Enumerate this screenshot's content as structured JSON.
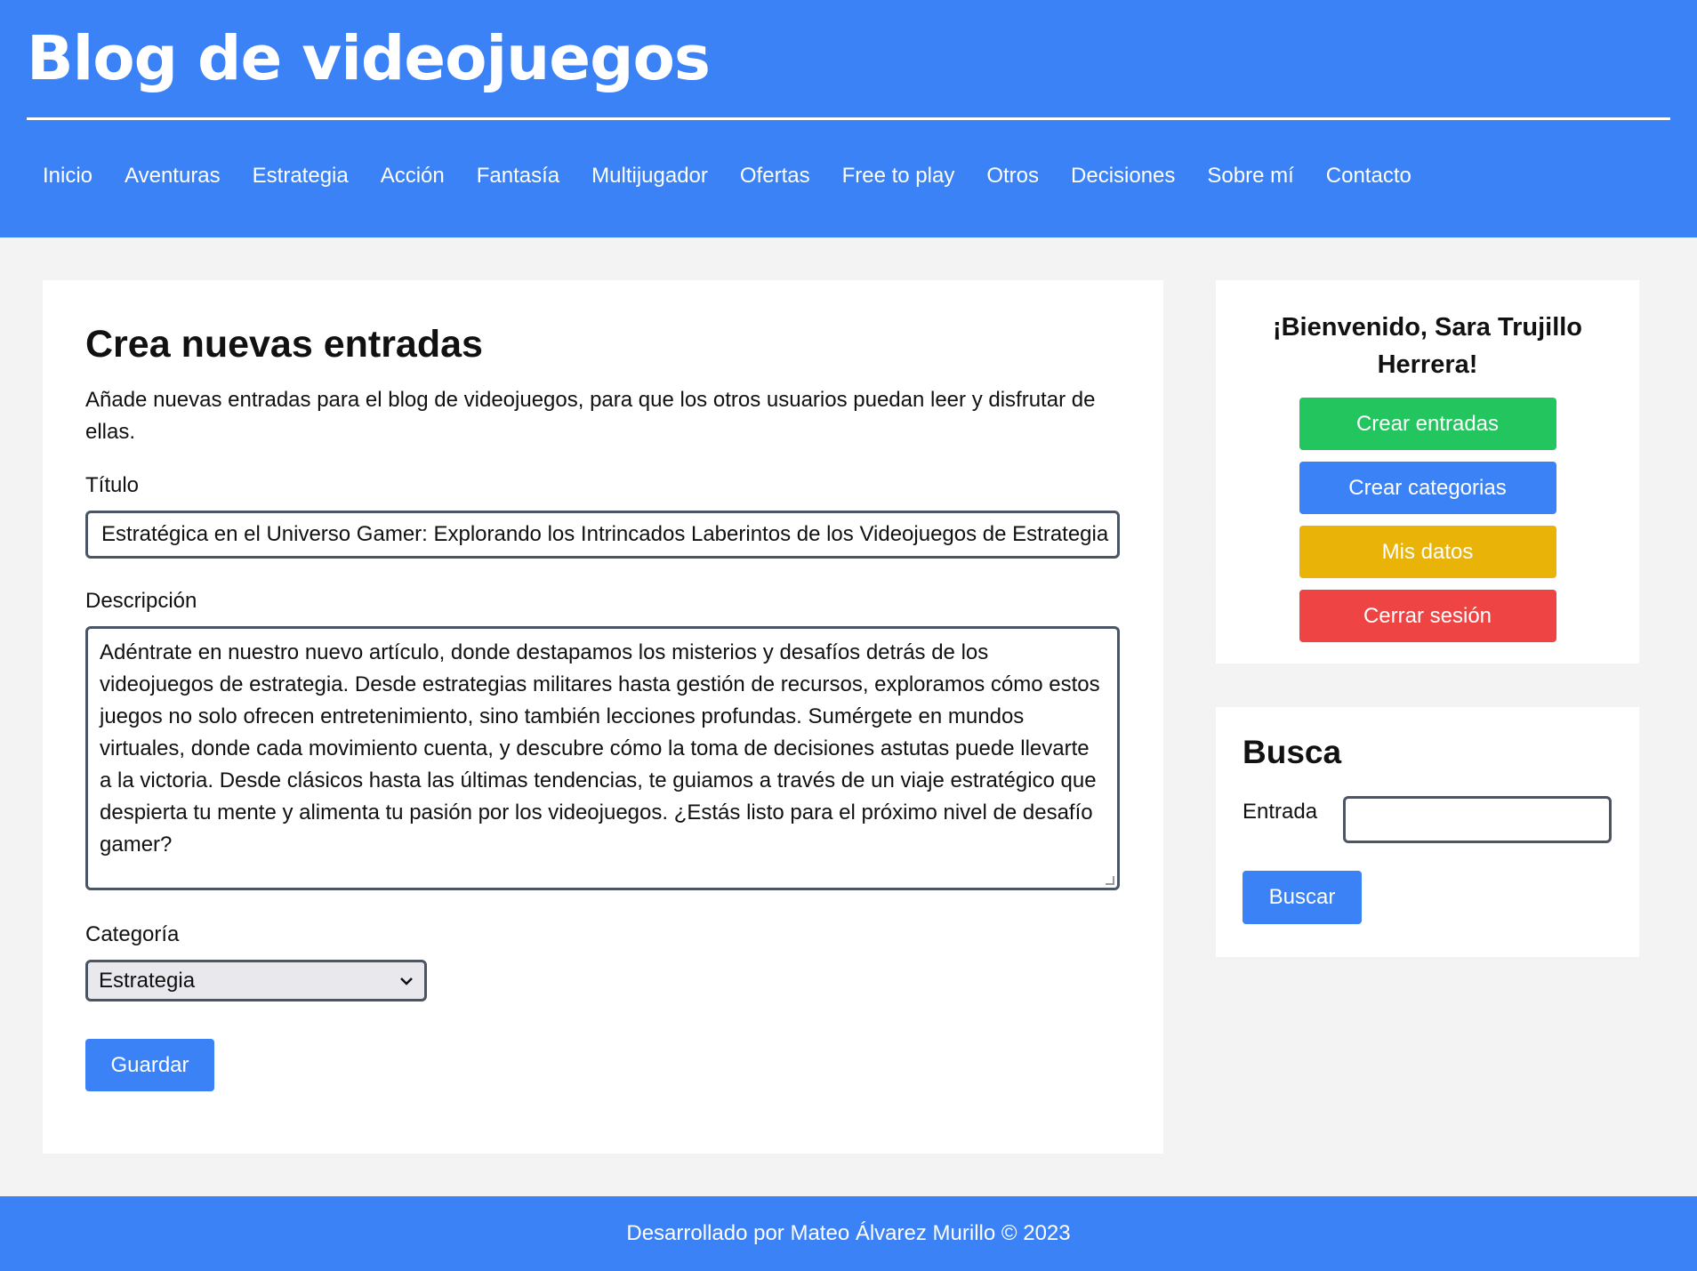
{
  "site": {
    "title": "Blog de videojuegos"
  },
  "nav": {
    "items": [
      "Inicio",
      "Aventuras",
      "Estrategia",
      "Acción",
      "Fantasía",
      "Multijugador",
      "Ofertas",
      "Free to play",
      "Otros",
      "Decisiones",
      "Sobre mí",
      "Contacto"
    ]
  },
  "form": {
    "heading": "Crea nuevas entradas",
    "intro": "Añade nuevas entradas para el blog de videojuegos, para que los otros usuarios puedan leer y disfrutar de ellas.",
    "title_label": "Título",
    "title_value": "Estratégica en el Universo Gamer: Explorando los Intrincados Laberintos de los Videojuegos de Estrategia",
    "description_label": "Descripción",
    "description_value": "Adéntrate en nuestro nuevo artículo, donde destapamos los misterios y desafíos detrás de los videojuegos de estrategia. Desde estrategias militares hasta gestión de recursos, exploramos cómo estos juegos no solo ofrecen entretenimiento, sino también lecciones profundas. Sumérgete en mundos virtuales, donde cada movimiento cuenta, y descubre cómo la toma de decisiones astutas puede llevarte a la victoria. Desde clásicos hasta las últimas tendencias, te guiamos a través de un viaje estratégico que despierta tu mente y alimenta tu pasión por los videojuegos. ¿Estás listo para el próximo nivel de desafío gamer?",
    "category_label": "Categoría",
    "category_selected": "Estrategia",
    "save_label": "Guardar"
  },
  "sidebar": {
    "welcome": "¡Bienvenido, Sara Trujillo Herrera!",
    "buttons": {
      "create_posts": "Crear entradas",
      "create_categories": "Crear categorias",
      "my_data": "Mis datos",
      "logout": "Cerrar sesión"
    },
    "search": {
      "heading": "Busca",
      "label": "Entrada",
      "value": "",
      "button": "Buscar"
    }
  },
  "footer": {
    "text": "Desarrollado por Mateo Álvarez Murillo © 2023"
  },
  "colors": {
    "primary": "#3b82f6",
    "success": "#22c55e",
    "warning": "#eab308",
    "danger": "#ef4444"
  }
}
